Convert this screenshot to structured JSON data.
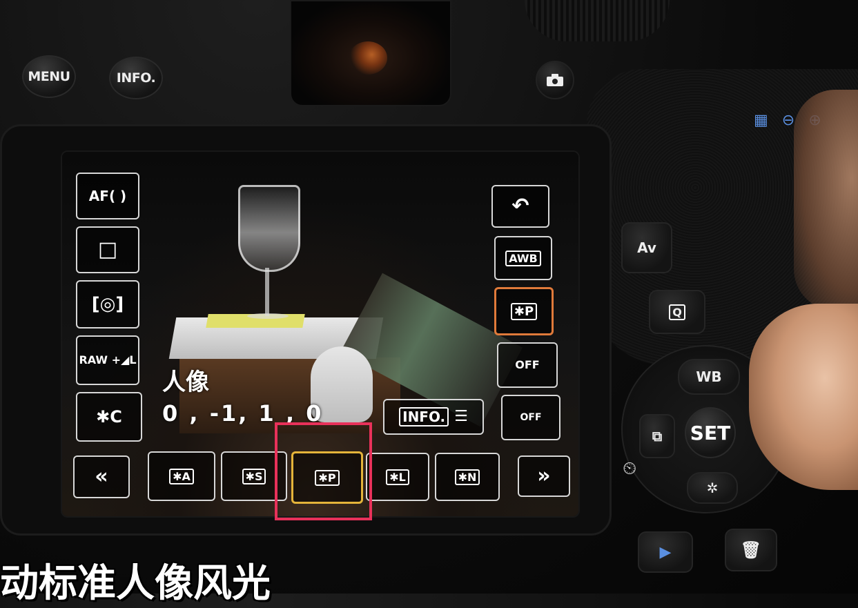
{
  "camera_buttons": {
    "menu": "MENU",
    "info": "INFO.",
    "av": "Av",
    "q": "Q",
    "wb": "WB",
    "set": "SET"
  },
  "screen": {
    "left_column": [
      "AF( )",
      "□",
      "[◎]",
      "RAW +◢L",
      "✱C"
    ],
    "right_column": [
      "↶",
      "AWB",
      "✱P",
      "OFF",
      "OFF"
    ],
    "picture_style_name": "人像",
    "picture_style_values": "0 , -1, 1 , 0",
    "info_button": "INFO.",
    "bottom_bar": {
      "prev": "«",
      "items": [
        "✱A",
        "✱S",
        "✱P",
        "✱L",
        "✱N"
      ],
      "selected_index": 2,
      "next": "»"
    }
  },
  "subtitle": "动标准人像风光",
  "colors": {
    "selected_orange": "#e07a3a",
    "cursor_yellow": "#e4b43a",
    "highlight_pink": "#e8315a",
    "zoom_blue": "#5a8fe0"
  }
}
